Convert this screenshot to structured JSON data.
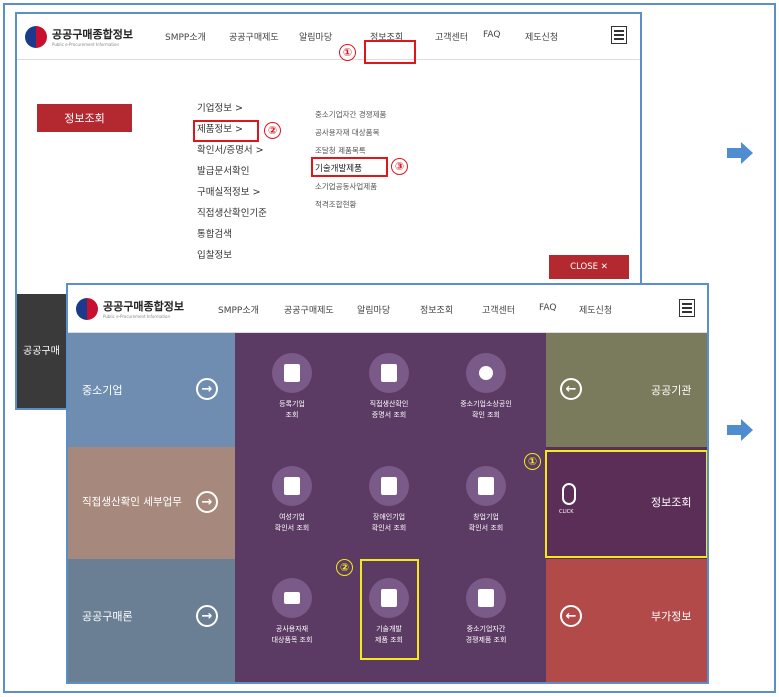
{
  "site": {
    "title": "공공구매종합정보",
    "subtitle": "Public e-Procurement Information"
  },
  "nav": [
    "SMPP소개",
    "공공구매제도",
    "알림마당",
    "정보조회",
    "고객센터",
    "FAQ",
    "제도신청"
  ],
  "step_numbers": [
    "①",
    "②",
    "③"
  ],
  "menu": {
    "title": "정보조회",
    "col1": [
      "기업정보 >",
      "제품정보 >",
      "확인서/증명서 >",
      "발급문서확인",
      "구매실적정보 >",
      "직접생산확인기준",
      "통합검색",
      "입찰정보"
    ],
    "col2": [
      "중소기업자간 경쟁제품",
      "공사용자재 대상품목",
      "조달청 제품목록",
      "기술개발제품",
      "소기업공동사업제품",
      "적격조합현황"
    ],
    "close_label": "CLOSE ✕"
  },
  "behind_label": "공공구매",
  "main": {
    "left": [
      {
        "label": "중소기업",
        "color": "#6f8db0"
      },
      {
        "label": "직접생산확인 세부업무",
        "color": "#a6897c"
      },
      {
        "label": "공공구매론",
        "color": "#6b7f94"
      }
    ],
    "center_color": "#5b3a63",
    "items": [
      {
        "caption": "등록기업\n조회"
      },
      {
        "caption": "직접생산확인\n증명서 조회"
      },
      {
        "caption": "중소기업소상공인\n확인 조회"
      },
      {
        "caption": "여성기업\n확인서 조회"
      },
      {
        "caption": "장애인기업\n확인서 조회"
      },
      {
        "caption": "창업기업\n확인서 조회"
      },
      {
        "caption": "공사용자재\n대상품목 조회"
      },
      {
        "caption": "기술개발\n제품 조회"
      },
      {
        "caption": "중소기업자간\n경쟁제품 조회"
      }
    ],
    "right": [
      {
        "label": "공공기관",
        "color": "#7a7a5c"
      },
      {
        "label": "정보조회",
        "color": "#5b2e58"
      },
      {
        "label": "부가정보",
        "color": "#b24a4a"
      }
    ],
    "click_label": "CLICK",
    "arrow_right": "→",
    "arrow_left": "←"
  }
}
